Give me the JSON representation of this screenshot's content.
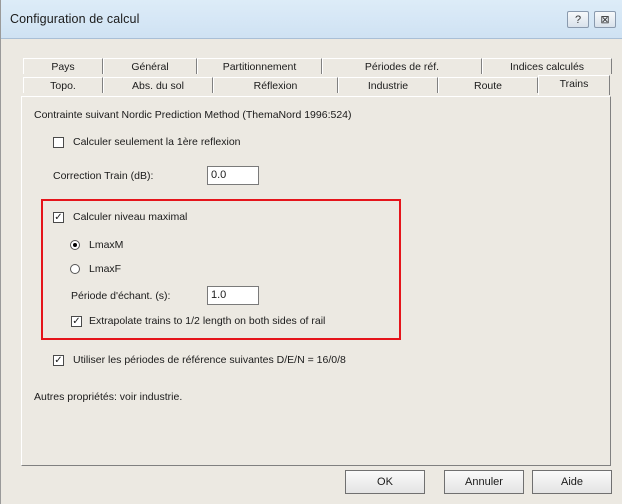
{
  "window": {
    "title": "Configuration de calcul",
    "help_btn": "?",
    "close_btn": "⊠"
  },
  "tabs_row1": [
    "Pays",
    "Général",
    "Partitionnement",
    "Périodes de réf.",
    "Indices calculés"
  ],
  "tabs_row2": [
    "Topo.",
    "Abs. du sol",
    "Réflexion",
    "Industrie",
    "Route",
    "Trains"
  ],
  "active_tab": "Trains",
  "panel": {
    "method_text": "Contrainte suivant Nordic Prediction Method (ThemaNord 1996:524)",
    "first_reflection": {
      "label": "Calculer seulement la 1ère reflexion",
      "checked": false
    },
    "correction": {
      "label": "Correction Train (dB):",
      "value": "0.0"
    },
    "max_level": {
      "label": "Calculer niveau maximal",
      "checked": true
    },
    "radio_lmaxm": {
      "label": "LmaxM",
      "selected": true
    },
    "radio_lmaxf": {
      "label": "LmaxF",
      "selected": false
    },
    "periode": {
      "label": "Période d'échant. (s):",
      "value": "1.0"
    },
    "extrapolate": {
      "label": "Extrapolate trains to 1/2 length on both sides of rail",
      "checked": true
    },
    "ref_periods": {
      "label": "Utiliser les périodes de référence suivantes D/E/N = 16/0/8",
      "checked": true
    },
    "other_props": "Autres propriétés: voir industrie.",
    "check_mark": "✓"
  },
  "buttons": {
    "ok": "OK",
    "cancel": "Annuler",
    "help": "Aide"
  },
  "colors": {
    "highlight_box": "#e5141b",
    "dialog_bg": "#ece9e2"
  }
}
